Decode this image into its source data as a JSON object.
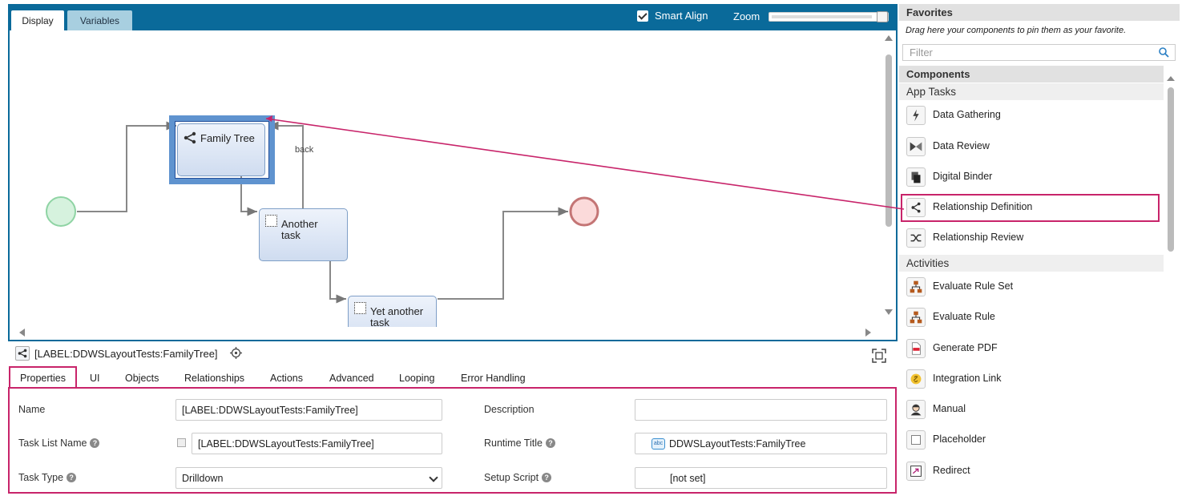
{
  "canvas": {
    "tabs": [
      {
        "label": "Display"
      },
      {
        "label": "Variables"
      }
    ],
    "smart_align_label": "Smart Align",
    "smart_align_checked": true,
    "zoom_label": "Zoom",
    "zoom_level": 1.0
  },
  "diagram": {
    "tasks": {
      "family_tree": "Family Tree",
      "another": [
        "Another",
        "task"
      ],
      "yet_another": [
        "Yet another",
        "task"
      ]
    },
    "edge_label_back": "back"
  },
  "properties": {
    "title": "[LABEL:DDWSLayoutTests:FamilyTree]",
    "tabs": [
      {
        "label": "Properties"
      },
      {
        "label": "UI"
      },
      {
        "label": "Objects"
      },
      {
        "label": "Relationships"
      },
      {
        "label": "Actions"
      },
      {
        "label": "Advanced"
      },
      {
        "label": "Looping"
      },
      {
        "label": "Error Handling"
      }
    ],
    "fields": {
      "name_label": "Name",
      "name_value": "[LABEL:DDWSLayoutTests:FamilyTree]",
      "description_label": "Description",
      "description_value": "",
      "task_list_name_label": "Task List Name",
      "task_list_name_value": "[LABEL:DDWSLayoutTests:FamilyTree]",
      "runtime_title_label": "Runtime Title",
      "runtime_title_value": "DDWSLayoutTests:FamilyTree",
      "runtime_title_icon": "abc",
      "task_type_label": "Task Type",
      "task_type_value": "Drilldown",
      "setup_script_label": "Setup Script",
      "setup_script_value": "[not set]"
    },
    "help_glyph": "?"
  },
  "sidebar": {
    "favorites_header": "Favorites",
    "favorites_hint": "Drag here your components to pin them as your favorite.",
    "filter_placeholder": "Filter",
    "components_header": "Components",
    "categories": [
      {
        "name": "App Tasks",
        "items": [
          {
            "label": "Data Gathering",
            "icon": "lightning-icon"
          },
          {
            "label": "Data Review",
            "icon": "review-icon"
          },
          {
            "label": "Digital Binder",
            "icon": "binder-icon"
          },
          {
            "label": "Relationship Definition",
            "icon": "share-icon"
          },
          {
            "label": "Relationship Review",
            "icon": "shuffle-icon"
          }
        ]
      },
      {
        "name": "Activities",
        "items": [
          {
            "label": "Evaluate Rule Set",
            "icon": "hierarchy-icon"
          },
          {
            "label": "Evaluate Rule",
            "icon": "hierarchy-icon"
          },
          {
            "label": "Generate PDF",
            "icon": "pdf-icon"
          },
          {
            "label": "Integration Link",
            "icon": "link-icon"
          },
          {
            "label": "Manual",
            "icon": "person-icon"
          },
          {
            "label": "Placeholder",
            "icon": "placeholder-icon"
          },
          {
            "label": "Redirect",
            "icon": "redirect-icon"
          }
        ]
      }
    ]
  },
  "colors": {
    "accent": "#0a6a9a",
    "highlight": "#c8246a",
    "selection": "#5f93cf"
  }
}
